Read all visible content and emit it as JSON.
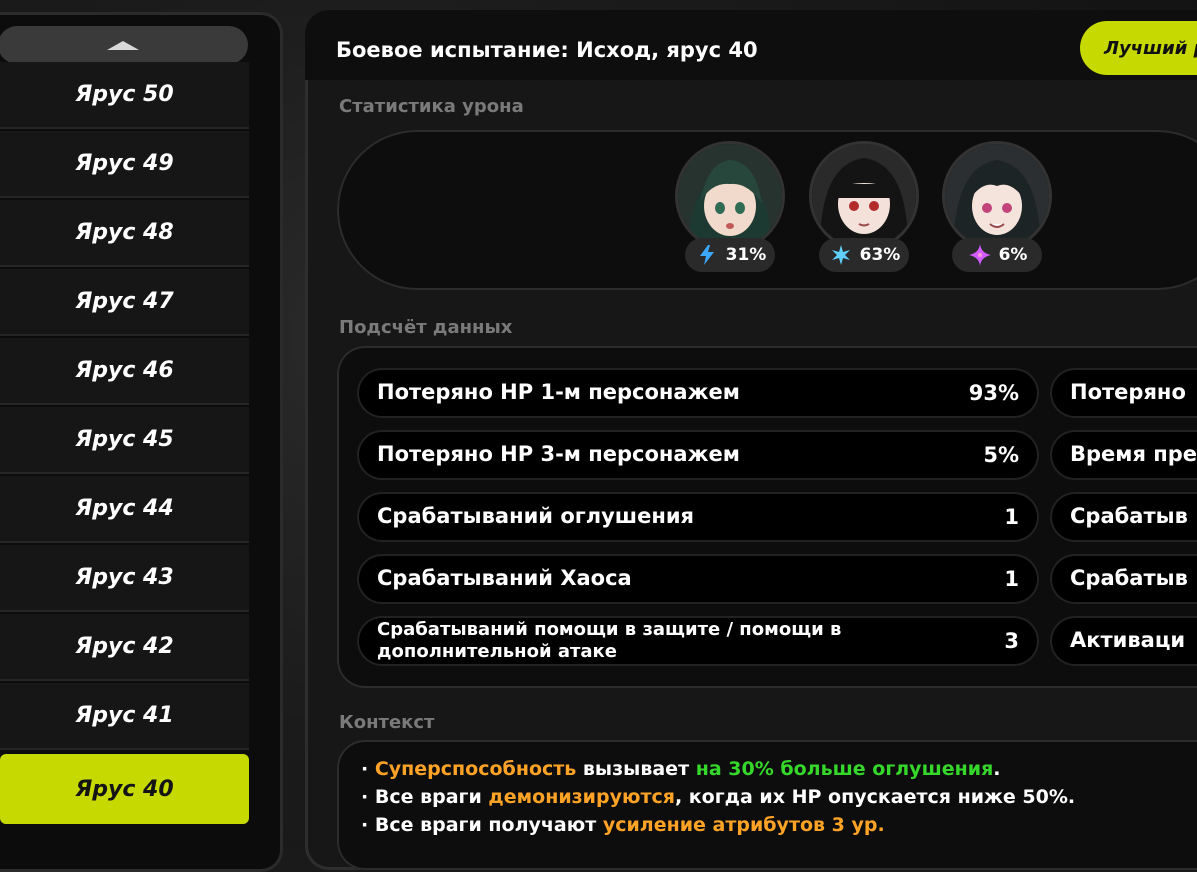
{
  "sidebar": {
    "tiers": [
      {
        "label": "Ярус 50",
        "active": false
      },
      {
        "label": "Ярус 49",
        "active": false
      },
      {
        "label": "Ярус 48",
        "active": false
      },
      {
        "label": "Ярус 47",
        "active": false
      },
      {
        "label": "Ярус 46",
        "active": false
      },
      {
        "label": "Ярус 45",
        "active": false
      },
      {
        "label": "Ярус 44",
        "active": false
      },
      {
        "label": "Ярус 43",
        "active": false
      },
      {
        "label": "Ярус 42",
        "active": false
      },
      {
        "label": "Ярус 41",
        "active": false
      },
      {
        "label": "Ярус 40",
        "active": true
      }
    ]
  },
  "header": {
    "title": "Боевое испытание: Исход, ярус 40",
    "best_button": "Лучший р"
  },
  "damage_stats": {
    "label": "Статистика урона",
    "agents": [
      {
        "element_icon": "electric-icon",
        "percent": "31%",
        "color": "#3aa9ff"
      },
      {
        "element_icon": "ice-icon",
        "percent": "63%",
        "color": "#5fd0ff"
      },
      {
        "element_icon": "ether-icon",
        "percent": "6%",
        "color": "#d35cff"
      }
    ]
  },
  "data_count": {
    "label": "Подсчёт данных",
    "left": [
      {
        "label": "Потеряно HP 1-м персонажем",
        "value": "93%"
      },
      {
        "label": "Потеряно HP 3-м персонажем",
        "value": "5%"
      },
      {
        "label": "Срабатываний оглушения",
        "value": "1"
      },
      {
        "label": "Срабатываний Хаоса",
        "value": "1"
      },
      {
        "label": "Срабатываний помощи в защите / помощи в дополнительной атаке",
        "value": "3"
      }
    ],
    "right": [
      {
        "label": "Потеряно"
      },
      {
        "label": "Время пре"
      },
      {
        "label": "Срабатыв"
      },
      {
        "label": "Срабатыв"
      },
      {
        "label": "Активаци"
      }
    ]
  },
  "context": {
    "label": "Контекст",
    "lines": [
      {
        "bullet": "· ",
        "parts": [
          {
            "text": "Суперспособность",
            "color": "orange"
          },
          {
            "text": " вызывает ",
            "color": "white"
          },
          {
            "text": "на 30% больше оглушения",
            "color": "green"
          },
          {
            "text": ".",
            "color": "white"
          }
        ]
      },
      {
        "bullet": "· ",
        "parts": [
          {
            "text": "Все враги ",
            "color": "white"
          },
          {
            "text": "демонизируются",
            "color": "orange"
          },
          {
            "text": ", когда их HP опускается ниже 50%.",
            "color": "white"
          }
        ]
      },
      {
        "bullet": "· ",
        "parts": [
          {
            "text": "Все враги получают ",
            "color": "white"
          },
          {
            "text": "усиление атрибутов 3 ур.",
            "color": "orange"
          }
        ]
      }
    ]
  }
}
